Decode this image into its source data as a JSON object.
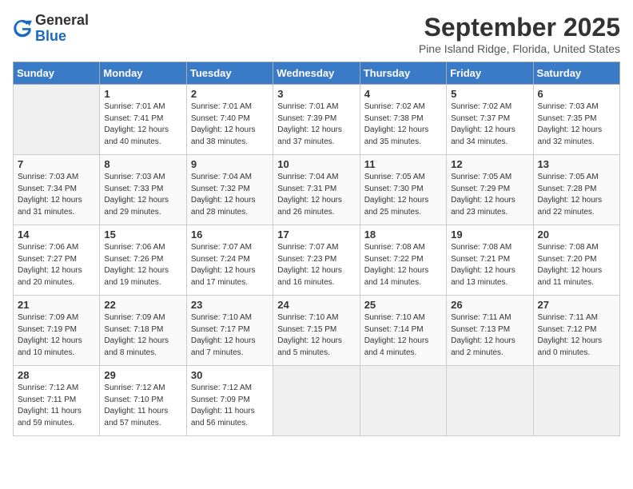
{
  "logo": {
    "general": "General",
    "blue": "Blue"
  },
  "header": {
    "month": "September 2025",
    "location": "Pine Island Ridge, Florida, United States"
  },
  "weekdays": [
    "Sunday",
    "Monday",
    "Tuesday",
    "Wednesday",
    "Thursday",
    "Friday",
    "Saturday"
  ],
  "weeks": [
    [
      {
        "day": "",
        "sunrise": "",
        "sunset": "",
        "daylight": ""
      },
      {
        "day": "1",
        "sunrise": "7:01 AM",
        "sunset": "7:41 PM",
        "daylight": "12 hours and 40 minutes."
      },
      {
        "day": "2",
        "sunrise": "7:01 AM",
        "sunset": "7:40 PM",
        "daylight": "12 hours and 38 minutes."
      },
      {
        "day": "3",
        "sunrise": "7:01 AM",
        "sunset": "7:39 PM",
        "daylight": "12 hours and 37 minutes."
      },
      {
        "day": "4",
        "sunrise": "7:02 AM",
        "sunset": "7:38 PM",
        "daylight": "12 hours and 35 minutes."
      },
      {
        "day": "5",
        "sunrise": "7:02 AM",
        "sunset": "7:37 PM",
        "daylight": "12 hours and 34 minutes."
      },
      {
        "day": "6",
        "sunrise": "7:03 AM",
        "sunset": "7:35 PM",
        "daylight": "12 hours and 32 minutes."
      }
    ],
    [
      {
        "day": "7",
        "sunrise": "7:03 AM",
        "sunset": "7:34 PM",
        "daylight": "12 hours and 31 minutes."
      },
      {
        "day": "8",
        "sunrise": "7:03 AM",
        "sunset": "7:33 PM",
        "daylight": "12 hours and 29 minutes."
      },
      {
        "day": "9",
        "sunrise": "7:04 AM",
        "sunset": "7:32 PM",
        "daylight": "12 hours and 28 minutes."
      },
      {
        "day": "10",
        "sunrise": "7:04 AM",
        "sunset": "7:31 PM",
        "daylight": "12 hours and 26 minutes."
      },
      {
        "day": "11",
        "sunrise": "7:05 AM",
        "sunset": "7:30 PM",
        "daylight": "12 hours and 25 minutes."
      },
      {
        "day": "12",
        "sunrise": "7:05 AM",
        "sunset": "7:29 PM",
        "daylight": "12 hours and 23 minutes."
      },
      {
        "day": "13",
        "sunrise": "7:05 AM",
        "sunset": "7:28 PM",
        "daylight": "12 hours and 22 minutes."
      }
    ],
    [
      {
        "day": "14",
        "sunrise": "7:06 AM",
        "sunset": "7:27 PM",
        "daylight": "12 hours and 20 minutes."
      },
      {
        "day": "15",
        "sunrise": "7:06 AM",
        "sunset": "7:26 PM",
        "daylight": "12 hours and 19 minutes."
      },
      {
        "day": "16",
        "sunrise": "7:07 AM",
        "sunset": "7:24 PM",
        "daylight": "12 hours and 17 minutes."
      },
      {
        "day": "17",
        "sunrise": "7:07 AM",
        "sunset": "7:23 PM",
        "daylight": "12 hours and 16 minutes."
      },
      {
        "day": "18",
        "sunrise": "7:08 AM",
        "sunset": "7:22 PM",
        "daylight": "12 hours and 14 minutes."
      },
      {
        "day": "19",
        "sunrise": "7:08 AM",
        "sunset": "7:21 PM",
        "daylight": "12 hours and 13 minutes."
      },
      {
        "day": "20",
        "sunrise": "7:08 AM",
        "sunset": "7:20 PM",
        "daylight": "12 hours and 11 minutes."
      }
    ],
    [
      {
        "day": "21",
        "sunrise": "7:09 AM",
        "sunset": "7:19 PM",
        "daylight": "12 hours and 10 minutes."
      },
      {
        "day": "22",
        "sunrise": "7:09 AM",
        "sunset": "7:18 PM",
        "daylight": "12 hours and 8 minutes."
      },
      {
        "day": "23",
        "sunrise": "7:10 AM",
        "sunset": "7:17 PM",
        "daylight": "12 hours and 7 minutes."
      },
      {
        "day": "24",
        "sunrise": "7:10 AM",
        "sunset": "7:15 PM",
        "daylight": "12 hours and 5 minutes."
      },
      {
        "day": "25",
        "sunrise": "7:10 AM",
        "sunset": "7:14 PM",
        "daylight": "12 hours and 4 minutes."
      },
      {
        "day": "26",
        "sunrise": "7:11 AM",
        "sunset": "7:13 PM",
        "daylight": "12 hours and 2 minutes."
      },
      {
        "day": "27",
        "sunrise": "7:11 AM",
        "sunset": "7:12 PM",
        "daylight": "12 hours and 0 minutes."
      }
    ],
    [
      {
        "day": "28",
        "sunrise": "7:12 AM",
        "sunset": "7:11 PM",
        "daylight": "11 hours and 59 minutes."
      },
      {
        "day": "29",
        "sunrise": "7:12 AM",
        "sunset": "7:10 PM",
        "daylight": "11 hours and 57 minutes."
      },
      {
        "day": "30",
        "sunrise": "7:12 AM",
        "sunset": "7:09 PM",
        "daylight": "11 hours and 56 minutes."
      },
      {
        "day": "",
        "sunrise": "",
        "sunset": "",
        "daylight": ""
      },
      {
        "day": "",
        "sunrise": "",
        "sunset": "",
        "daylight": ""
      },
      {
        "day": "",
        "sunrise": "",
        "sunset": "",
        "daylight": ""
      },
      {
        "day": "",
        "sunrise": "",
        "sunset": "",
        "daylight": ""
      }
    ]
  ]
}
